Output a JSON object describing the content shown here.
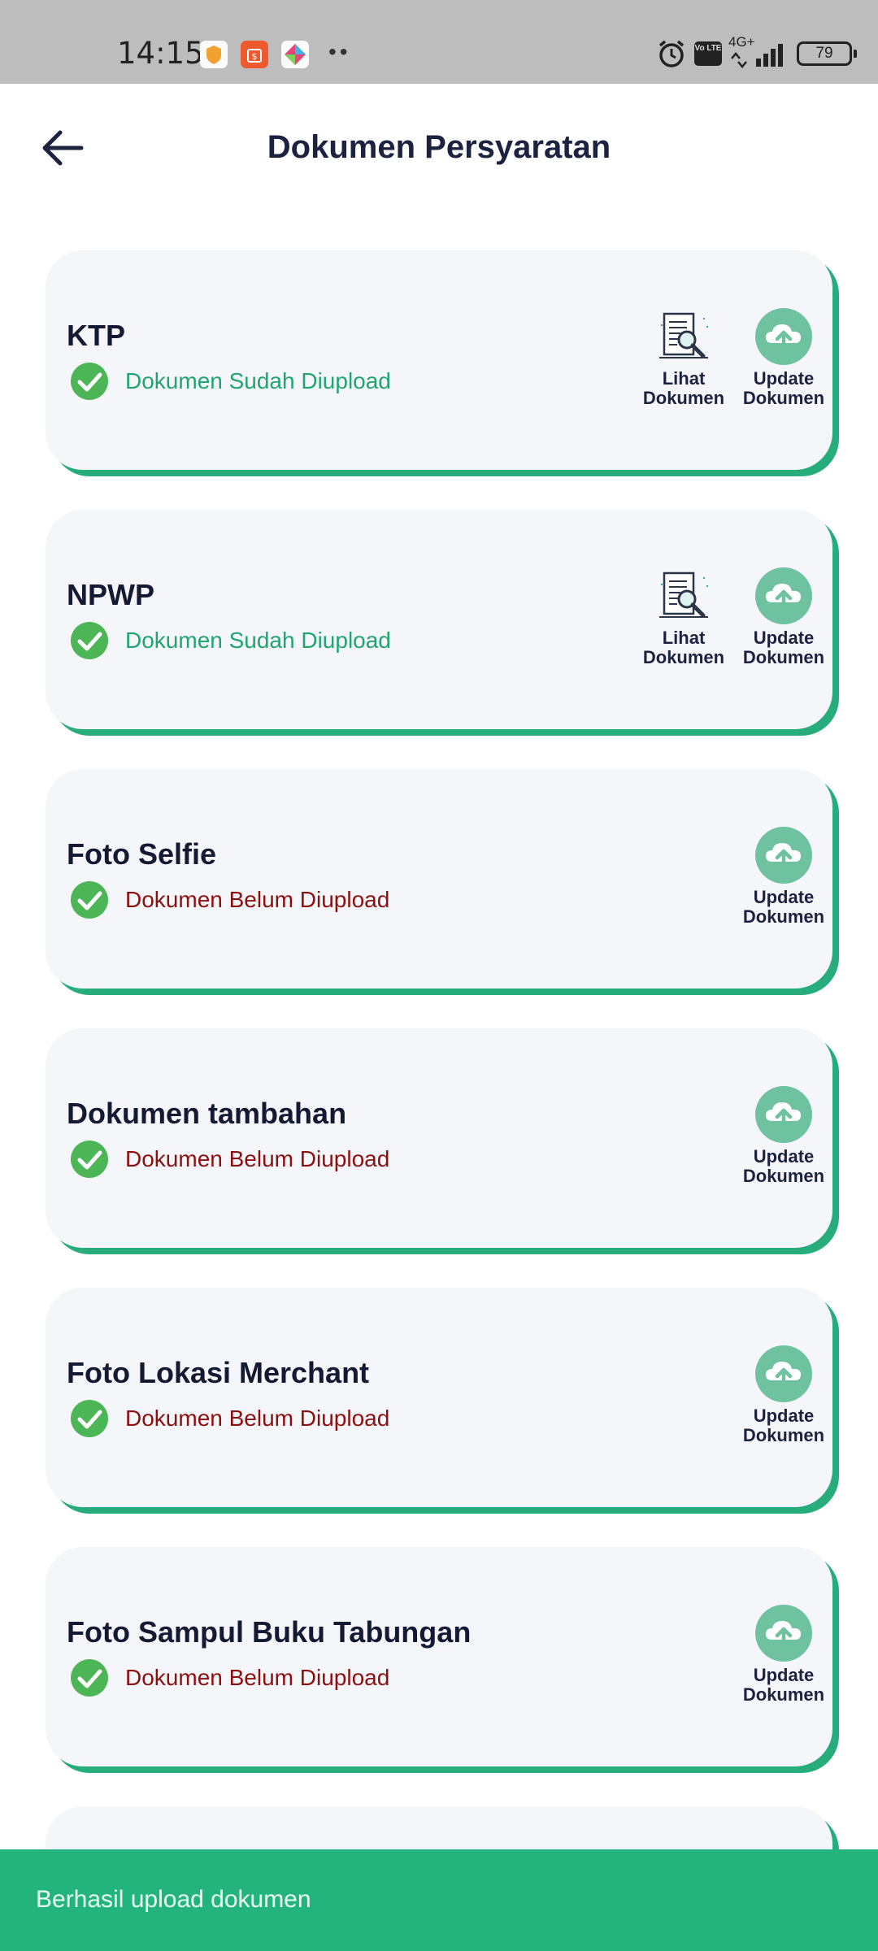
{
  "status_bar": {
    "time": "14:15",
    "network": "4G+",
    "volte": "Vo LTE",
    "battery": "79"
  },
  "header": {
    "title": "Dokumen Persyaratan"
  },
  "labels": {
    "view": "Lihat Dokumen",
    "update": "Update Dokumen"
  },
  "documents": [
    {
      "title": "KTP",
      "status": "Dokumen Sudah Diupload"
    },
    {
      "title": "NPWP",
      "status": "Dokumen Sudah Diupload"
    },
    {
      "title": "Foto Selfie",
      "status": "Dokumen Belum Diupload"
    },
    {
      "title": "Dokumen tambahan",
      "status": "Dokumen Belum Diupload"
    },
    {
      "title": "Foto Lokasi Merchant",
      "status": "Dokumen Belum Diupload"
    },
    {
      "title": "Foto Sampul Buku Tabungan",
      "status": "Dokumen Belum Diupload"
    }
  ],
  "snackbar": {
    "message": "Berhasil upload dokumen"
  },
  "colors": {
    "accent": "#22b47c",
    "uploaded": "#22a46f",
    "not_uploaded": "#8b1010",
    "check": "#4cb556",
    "cloud": "#6fc2a0"
  }
}
